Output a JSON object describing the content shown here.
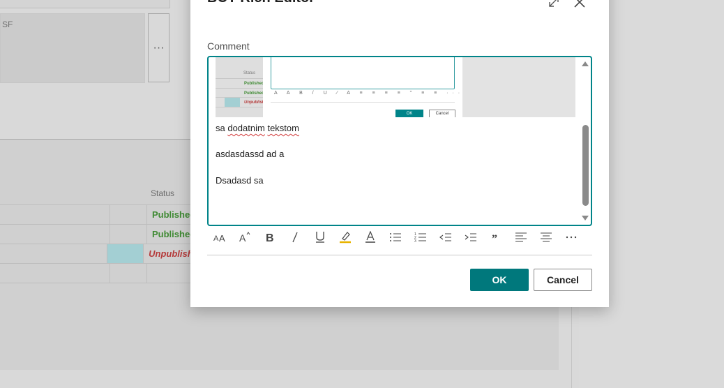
{
  "background": {
    "field_text": "SF",
    "more_button": "···",
    "status_header": "Status",
    "rows": [
      {
        "status": "Published",
        "kind": "published",
        "highlight": false
      },
      {
        "status": "Published",
        "kind": "published",
        "highlight": false
      },
      {
        "status": "Unpublished",
        "kind": "unpublished",
        "highlight": true
      },
      {
        "status": "",
        "kind": "empty",
        "highlight": false
      }
    ]
  },
  "dialog": {
    "title": "BCY Rich Editor",
    "field_label": "Comment",
    "embedded_image": {
      "status_label": "Status",
      "items": [
        "Published",
        "Published",
        "Unpublished"
      ],
      "ok_label": "OK",
      "cancel_label": "Cancel"
    },
    "content_lines": [
      "sa dodatnim tekstom",
      "asdasdassd ad a",
      "Dsadasd sa"
    ],
    "toolbar": [
      {
        "icon": "font-size-icon"
      },
      {
        "icon": "superscript-icon"
      },
      {
        "icon": "bold-icon"
      },
      {
        "icon": "italic-icon"
      },
      {
        "icon": "underline-icon"
      },
      {
        "icon": "highlight-icon"
      },
      {
        "icon": "font-color-icon"
      },
      {
        "icon": "bullet-list-icon"
      },
      {
        "icon": "numbered-list-icon"
      },
      {
        "icon": "outdent-icon"
      },
      {
        "icon": "indent-icon"
      },
      {
        "icon": "quote-icon"
      },
      {
        "icon": "align-left-icon"
      },
      {
        "icon": "align-center-icon"
      },
      {
        "icon": "more-icon"
      }
    ],
    "ok_label": "OK",
    "cancel_label": "Cancel"
  },
  "colors": {
    "accent": "#008489",
    "published": "#3f8a33",
    "unpublished": "#b53a3a",
    "highlight_cell": "#a3cfd3"
  }
}
